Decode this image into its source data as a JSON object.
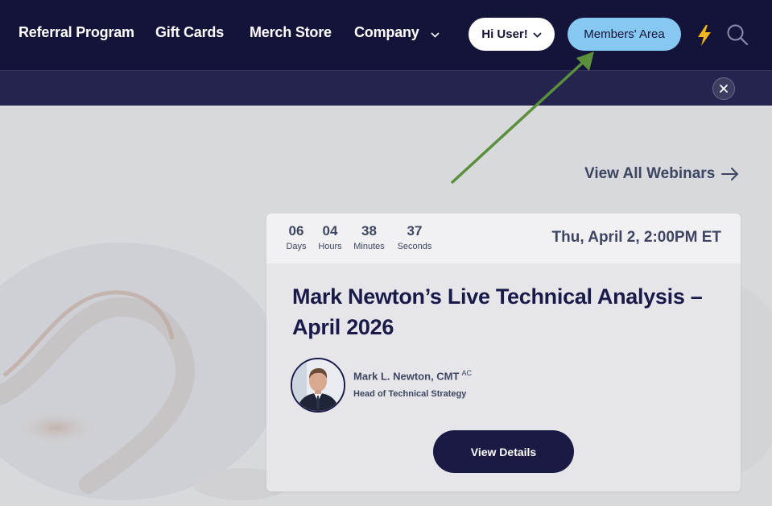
{
  "nav": {
    "links": [
      "Referral Program",
      "Gift Cards",
      "Merch Store",
      "Company"
    ],
    "user_button": "Hi User!",
    "members_button": "Members' Area",
    "icons": [
      "lightning-icon",
      "search-icon"
    ]
  },
  "banner": {
    "close_icon": "close-icon"
  },
  "webinars": {
    "view_all": "View All Webinars"
  },
  "card": {
    "countdown": [
      {
        "value": "06",
        "label": "Days"
      },
      {
        "value": "04",
        "label": "Hours"
      },
      {
        "value": "38",
        "label": "Minutes"
      },
      {
        "value": "37",
        "label": "Seconds"
      }
    ],
    "date": "Thu, April 2, 2:00PM ET",
    "title": "Mark Newton’s Live Technical Analysis – April 2026",
    "speaker_name": "Mark L. Newton, CMT",
    "speaker_suffix": "AC",
    "speaker_role": "Head of Technical Strategy",
    "button": "View Details"
  },
  "colors": {
    "nav_bg": "#14143a",
    "members_pill": "#86c8f2",
    "card_title": "#1a1a4a",
    "annotation_arrow": "#5a8f3c",
    "bolt": "#f2b51c"
  }
}
